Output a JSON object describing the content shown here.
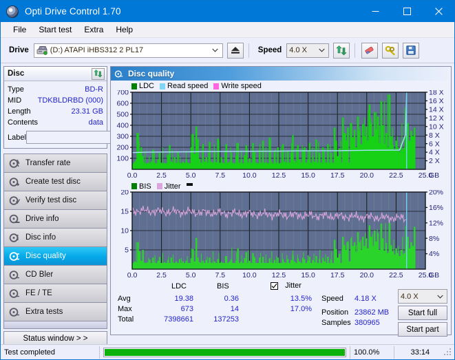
{
  "window": {
    "title": "Opti Drive Control 1.70",
    "app_icon": "disc-icon",
    "minimize": "–",
    "maximize": "☐",
    "close": "✕"
  },
  "menu": {
    "items": [
      "File",
      "Start test",
      "Extra",
      "Help"
    ]
  },
  "toolbar": {
    "drive_label": "Drive",
    "drive_value": "(D:)  ATAPI iHBS312  2 PL17",
    "eject_icon": "eject-icon",
    "speed_label": "Speed",
    "speed_value": "4.0 X",
    "refresh_icon": "refresh-icon",
    "eraser_icon": "eraser-icon",
    "tools_icon": "tools-icon",
    "save_icon": "save-icon"
  },
  "disc_panel": {
    "title": "Disc",
    "refresh_icon": "refresh-icon",
    "rows": [
      {
        "key": "Type",
        "value": "BD-R"
      },
      {
        "key": "MID",
        "value": "TDKBLDRBD (000)"
      },
      {
        "key": "Length",
        "value": "23.31 GB"
      },
      {
        "key": "Contents",
        "value": "data"
      }
    ],
    "label_key": "Label",
    "label_value": "",
    "label_placeholder": "",
    "disc_icon": "disc-icon"
  },
  "nav": {
    "items": [
      {
        "label": "Transfer rate",
        "icon": "disc-test-icon",
        "selected": false
      },
      {
        "label": "Create test disc",
        "icon": "disc-write-icon",
        "selected": false
      },
      {
        "label": "Verify test disc",
        "icon": "disc-verify-icon",
        "selected": false
      },
      {
        "label": "Drive info",
        "icon": "drive-info-icon",
        "selected": false
      },
      {
        "label": "Disc info",
        "icon": "disc-info-icon",
        "selected": false
      },
      {
        "label": "Disc quality",
        "icon": "disc-quality-icon",
        "selected": true
      },
      {
        "label": "CD Bler",
        "icon": "disc-bler-icon",
        "selected": false
      },
      {
        "label": "FE / TE",
        "icon": "disc-fete-icon",
        "selected": false
      },
      {
        "label": "Extra tests",
        "icon": "disc-extra-icon",
        "selected": false
      }
    ],
    "status_window": "Status window > >"
  },
  "main": {
    "header_title": "Disc quality",
    "header_icon": "disc-quality-icon"
  },
  "chart_data": [
    {
      "type": "area",
      "title": "LDC / Read speed",
      "legend": [
        {
          "label": "LDC",
          "color": "#00a000"
        },
        {
          "label": "Read speed",
          "color": "#7fd7f5"
        },
        {
          "label": "Write speed",
          "color": "#ff66e0"
        }
      ],
      "legend_position": "top-left",
      "grid": true,
      "plot_bg": "#5f6f91",
      "xlabel": "GB",
      "x": [
        0.0,
        2.5,
        5.0,
        7.5,
        10.0,
        12.5,
        15.0,
        17.5,
        20.0,
        22.5,
        25.0
      ],
      "xlim": [
        0.0,
        25.0
      ],
      "ylabel_left": "LDC",
      "ylim_left": [
        0,
        700
      ],
      "yticks_left": [
        100,
        200,
        300,
        400,
        500,
        600,
        700
      ],
      "ylabel_right": "Speed",
      "ylim_right": [
        0,
        18
      ],
      "yticks_right": [
        "2 X",
        "4 X",
        "6 X",
        "8 X",
        "10 X",
        "12 X",
        "14 X",
        "16 X",
        "18 X"
      ],
      "series": [
        {
          "name": "LDC",
          "color": "#00c800",
          "note": "green spiky error area, baseline ~30-60, many spikes 150-400 in first half, rising dense region 200-680 between 18 and 23.4 GB, data ends at 23.4 GB",
          "values": [
            55,
            70,
            90,
            330,
            150,
            200,
            120,
            60,
            55,
            60,
            55,
            70,
            180,
            60,
            55,
            90,
            150,
            60,
            55,
            60,
            55,
            130,
            220,
            70,
            60,
            110,
            60,
            160,
            60,
            55,
            70,
            60,
            90,
            60,
            55,
            200,
            320,
            140,
            390,
            270,
            95,
            60,
            230,
            70,
            110,
            60,
            250,
            70,
            60,
            160,
            65,
            280,
            60,
            110,
            60,
            55,
            230,
            60,
            70,
            150,
            60,
            55,
            120,
            240,
            60,
            90,
            55,
            130,
            220,
            60,
            100,
            60,
            240,
            160,
            60,
            55,
            180,
            60,
            260,
            60,
            60,
            55,
            290,
            70,
            55,
            160,
            60,
            200,
            55,
            60,
            230,
            70,
            60,
            170,
            60,
            150,
            310,
            80,
            60,
            220,
            90,
            60,
            180,
            200,
            60,
            90,
            240,
            60,
            120,
            70,
            270,
            60,
            150,
            60,
            200,
            90,
            60,
            230,
            60,
            150,
            60,
            380,
            260,
            120,
            190,
            60,
            470,
            330,
            260,
            380,
            60,
            420,
            290,
            360,
            200,
            480,
            350,
            230,
            410,
            300,
            390,
            260,
            590,
            420,
            300,
            520,
            360,
            480,
            240,
            620,
            400,
            230,
            330,
            200,
            680,
            300,
            220,
            180,
            260,
            200,
            160,
            240,
            180,
            200,
            300,
            420,
            260,
            350,
            300,
            380,
            0,
            0,
            0,
            0,
            0,
            0
          ]
        },
        {
          "name": "Read speed",
          "color": "#9adcf7",
          "note": "stepped rising line from ~4.0X near 0GB to ~4.6X near 23GB, then sharp vertical rise to 18X at 23.4 GB",
          "values_x_speed": [
            [
              0.0,
              3.9
            ],
            [
              1.2,
              4.0
            ],
            [
              2.6,
              4.05
            ],
            [
              5.0,
              4.1
            ],
            [
              6.0,
              4.15
            ],
            [
              9.0,
              4.2
            ],
            [
              12.5,
              4.25
            ],
            [
              14.0,
              4.3
            ],
            [
              17.5,
              4.35
            ],
            [
              20.0,
              4.45
            ],
            [
              22.8,
              4.5
            ],
            [
              23.3,
              8.0
            ],
            [
              23.4,
              18.0
            ]
          ]
        }
      ]
    },
    {
      "type": "area",
      "title": "BIS / Jitter",
      "legend": [
        {
          "label": "BIS",
          "color": "#00a000"
        },
        {
          "label": "Jitter",
          "color": "#dba6dd"
        }
      ],
      "legend_position": "top-left",
      "grid": true,
      "plot_bg": "#5f6f91",
      "xlabel": "GB",
      "x": [
        0.0,
        2.5,
        5.0,
        7.5,
        10.0,
        12.5,
        15.0,
        17.5,
        20.0,
        22.5,
        25.0
      ],
      "xlim": [
        0.0,
        25.0
      ],
      "ylabel_left": "BIS",
      "ylim_left": [
        0,
        20
      ],
      "yticks_left": [
        5,
        10,
        15,
        20
      ],
      "ylabel_right": "Jitter",
      "ylim_right": [
        0,
        20
      ],
      "yticks_right": [
        "4%",
        "8%",
        "12%",
        "16%",
        "20%"
      ],
      "series": [
        {
          "name": "BIS",
          "color": "#2ad42a",
          "note": "green spiky area, baseline ~1.5, spikes to 3-8 across disc, rising to 8-12 between 18 and 23.4 GB",
          "values": [
            1.6,
            2.0,
            1.8,
            7.0,
            4.6,
            2.2,
            5.0,
            1.7,
            1.6,
            1.8,
            2.5,
            1.6,
            3.0,
            1.7,
            1.6,
            2.2,
            3.2,
            1.6,
            1.6,
            1.8,
            1.6,
            2.4,
            1.6,
            3.0,
            1.7,
            1.6,
            2.0,
            1.6,
            2.6,
            1.6,
            2.0,
            1.6,
            2.2,
            1.6,
            1.6,
            2.8,
            5.2,
            2.0,
            8.1,
            3.0,
            1.8,
            1.6,
            2.2,
            1.6,
            2.4,
            1.6,
            3.0,
            1.7,
            1.6,
            2.0,
            1.6,
            2.6,
            1.6,
            1.9,
            1.6,
            1.6,
            3.4,
            1.6,
            2.0,
            2.6,
            1.6,
            1.6,
            2.2,
            5.4,
            1.6,
            2.0,
            1.6,
            2.8,
            4.4,
            1.6,
            2.2,
            1.6,
            4.2,
            3.0,
            1.6,
            1.6,
            3.0,
            1.6,
            3.2,
            1.6,
            1.6,
            1.6,
            2.8,
            1.8,
            1.6,
            2.4,
            1.6,
            3.0,
            1.6,
            1.6,
            2.6,
            1.8,
            1.6,
            2.6,
            1.6,
            2.4,
            3.6,
            2.0,
            1.6,
            2.8,
            2.0,
            1.6,
            3.0,
            2.6,
            1.6,
            2.2,
            3.2,
            1.6,
            2.4,
            1.8,
            3.4,
            1.6,
            2.6,
            1.6,
            3.0,
            2.0,
            1.6,
            3.2,
            1.6,
            2.6,
            1.6,
            7.6,
            5.2,
            3.0,
            4.0,
            1.6,
            8.4,
            6.2,
            5.0,
            7.2,
            2.0,
            8.0,
            6.0,
            7.0,
            4.4,
            9.6,
            7.0,
            5.0,
            8.4,
            6.0,
            8.0,
            5.4,
            11.4,
            8.4,
            6.0,
            10.0,
            7.2,
            9.4,
            5.0,
            11.8,
            8.0,
            4.8,
            6.8,
            4.2,
            12.0,
            6.2,
            4.6,
            3.8,
            5.4,
            4.2,
            3.4,
            5.0,
            3.8,
            4.2,
            6.2,
            8.4,
            5.4,
            7.0,
            6.0,
            11.0,
            0,
            0,
            0,
            0,
            0,
            0
          ]
        },
        {
          "name": "Jitter",
          "color": "#dba6dd",
          "note": "noisy pink line oscillating around 13-15%, slight downward drift from ~15% to ~13%",
          "mean_start": 15.2,
          "mean_end": 13.2,
          "amplitude": 1.3
        }
      ],
      "marker": {
        "color": "#6fd4f2",
        "x": 23.4,
        "note": "cyan vertical end-of-test marker"
      }
    }
  ],
  "stats": {
    "col_headers": [
      "LDC",
      "BIS"
    ],
    "jitter_label": "Jitter",
    "jitter_checked": true,
    "rows": [
      {
        "key": "Avg",
        "ldc": "19.38",
        "bis": "0.36",
        "jitter": "13.5%"
      },
      {
        "key": "Max",
        "ldc": "673",
        "bis": "14",
        "jitter": "17.0%"
      },
      {
        "key": "Total",
        "ldc": "7398661",
        "bis": "137253",
        "jitter": ""
      }
    ],
    "speed_key": "Speed",
    "speed_value": "4.18 X",
    "position_key": "Position",
    "position_value": "23862 MB",
    "samples_key": "Samples",
    "samples_value": "380965",
    "speed_select": "4.0 X",
    "start_full": "Start full",
    "start_part": "Start part"
  },
  "statusbar": {
    "message": "Test completed",
    "progress_pct": 100.0,
    "progress_text": "100.0%",
    "elapsed": "33:14"
  }
}
